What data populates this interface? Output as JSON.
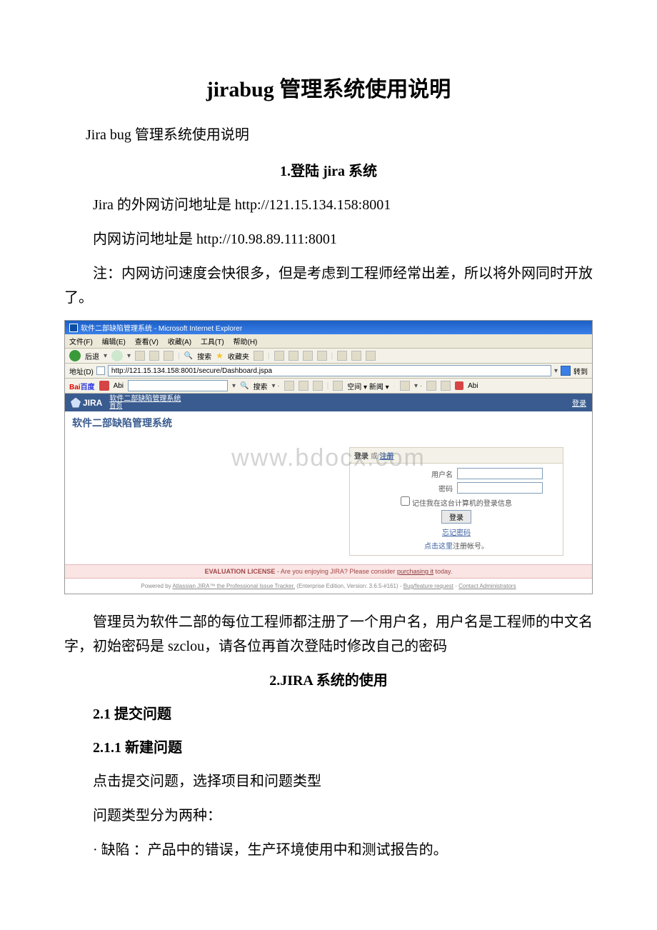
{
  "doc": {
    "title": "jirabug 管理系统使用说明",
    "subtitle": "Jira bug 管理系统使用说明",
    "section1": "1.登陆 jira 系统",
    "p1": "Jira 的外网访问地址是 http://121.15.134.158:8001",
    "p2": "内网访问地址是 http://10.98.89.111:8001",
    "p3": "注：内网访问速度会快很多，但是考虑到工程师经常出差，所以将外网同时开放了。",
    "p4": "管理员为软件二部的每位工程师都注册了一个用户名，用户名是工程师的中文名字，初始密码是 szclou，请各位再首次登陆时修改自己的密码",
    "section2": "2.JIRA 系统的使用",
    "h21": "2.1 提交问题",
    "h211": "2.1.1 新建问题",
    "p5": "点击提交问题，选择项目和问题类型",
    "p6": "问题类型分为两种：",
    "p7": "· 缺陷 ：产品中的错误，生产环境使用中和测试报告的。"
  },
  "ie": {
    "window_title": "软件二部缺陷管理系统 - Microsoft Internet Explorer",
    "menu": {
      "file": "文件(F)",
      "edit": "编辑(E)",
      "view": "查看(V)",
      "fav": "收藏(A)",
      "tools": "工具(T)",
      "help": "帮助(H)"
    },
    "toolbar": {
      "back": "后退",
      "search": "搜索",
      "fav": "收藏夹"
    },
    "addr_label": "地址(D)",
    "url": "http://121.15.134.158:8001/secure/Dashboard.jspa",
    "go": "转到"
  },
  "baidu": {
    "logo1": "Bai",
    "logo2": "百度",
    "abi": "Abi",
    "search_btn": "搜索",
    "items": "空间 ▾   新闻 ▾"
  },
  "jira": {
    "logo_text": "JIRA",
    "home": "首页",
    "breadcrumb": "软件二部缺陷管理系统",
    "login_link": "登录",
    "page_title": "软件二部缺陷管理系统",
    "watermark": "www.bdocx.com",
    "login_hdr_login": "登录",
    "login_hdr_or": " 或 ",
    "login_hdr_reg": "注册",
    "username": "用户名",
    "password": "密码",
    "remember": "记住我在这台计算机的登录信息",
    "login_btn": "登录",
    "forgot": "忘记密码",
    "reg_prefix": "点击这里",
    "reg_suffix": "注册帐号。"
  },
  "pink": {
    "bold": "EVALUATION LICENSE",
    "text1": " - Are you enjoying JIRA? Please consider ",
    "link": "purchasing it",
    "text2": " today."
  },
  "footer": {
    "text1": "Powered by ",
    "link1": "Atlassian JIRA™ the Professional Issue Tracker.",
    "text2": " (Enterprise Edition, Version: 3.6.5-#161) - ",
    "link2": "Bug/feature request",
    "text3": " - ",
    "link3": "Contact Administrators"
  }
}
